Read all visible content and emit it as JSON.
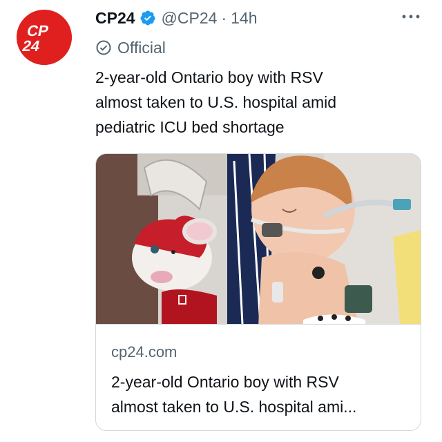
{
  "tweet": {
    "author": {
      "display_name": "CP24",
      "handle": "@CP24",
      "avatar_text": "CP24",
      "verified_icon": "verified-badge-icon",
      "label": "Official",
      "label_icon": "check-circle-icon"
    },
    "separator": "·",
    "time": "14h",
    "more_icon": "more-horizontal-icon",
    "text": "2-year-old Ontario boy with RSV\nalmost taken to U.S. hospital amid\npediatric ICU bed shortage"
  },
  "card": {
    "image_alt": "Toddler asleep in a hospital bed with breathing tube, holding a red plush toy",
    "domain": "cp24.com",
    "title": "2-year-old Ontario boy with RSV\nalmost taken to U.S. hospital ami..."
  },
  "colors": {
    "brand_red": "#e0201f",
    "verified_blue": "#1d9bf0",
    "muted_text": "#536471",
    "border": "#cfd9de"
  }
}
